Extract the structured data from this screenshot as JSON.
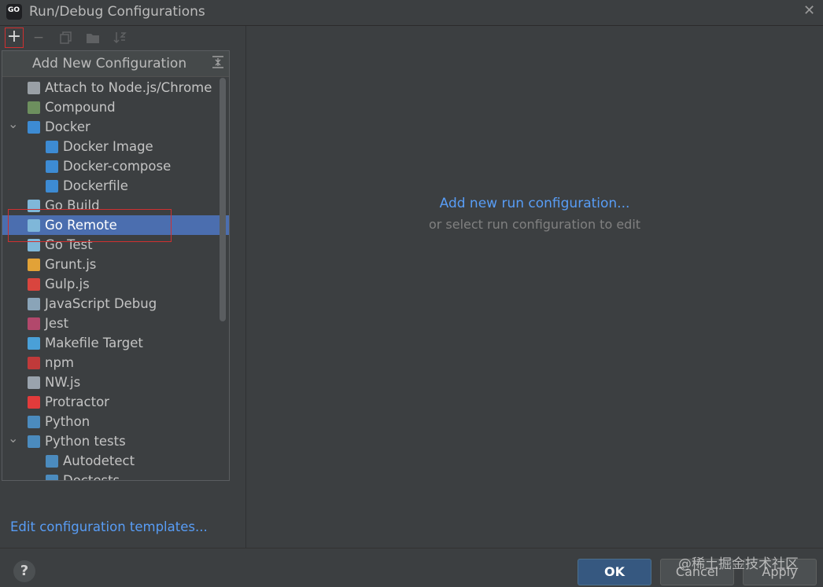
{
  "window": {
    "title": "Run/Debug Configurations",
    "app_icon_text": "GO"
  },
  "popup": {
    "title": "Add New Configuration",
    "items": [
      {
        "label": "Attach to Node.js/Chrome",
        "icon": "nodejs-attach-icon",
        "color": "#9aa0a6"
      },
      {
        "label": "Compound",
        "icon": "compound-icon",
        "color": "#6d8f5e"
      },
      {
        "label": "Docker",
        "icon": "docker-icon",
        "color": "#3d8bd3",
        "expanded": true
      },
      {
        "label": "Docker Image",
        "icon": "docker-icon",
        "color": "#3d8bd3"
      },
      {
        "label": "Docker-compose",
        "icon": "docker-icon",
        "color": "#3d8bd3"
      },
      {
        "label": "Dockerfile",
        "icon": "docker-icon",
        "color": "#3d8bd3"
      },
      {
        "label": "Go Build",
        "icon": "gopher-icon",
        "color": "#7fb7d9"
      },
      {
        "label": "Go Remote",
        "icon": "go-remote-icon",
        "color": "#7fb7d9",
        "selected": true
      },
      {
        "label": "Go Test",
        "icon": "gopher-icon",
        "color": "#7fb7d9"
      },
      {
        "label": "Grunt.js",
        "icon": "grunt-icon",
        "color": "#e2a237"
      },
      {
        "label": "Gulp.js",
        "icon": "gulp-icon",
        "color": "#d9453e"
      },
      {
        "label": "JavaScript Debug",
        "icon": "js-debug-icon",
        "color": "#8aa4b8"
      },
      {
        "label": "Jest",
        "icon": "jest-icon",
        "color": "#b2486c"
      },
      {
        "label": "Makefile Target",
        "icon": "makefile-icon",
        "color": "#4aa0d8"
      },
      {
        "label": "npm",
        "icon": "npm-icon",
        "color": "#c03a3a"
      },
      {
        "label": "NW.js",
        "icon": "nwjs-icon",
        "color": "#9aa3ad"
      },
      {
        "label": "Protractor",
        "icon": "protractor-icon",
        "color": "#e23b3b"
      },
      {
        "label": "Python",
        "icon": "python-icon",
        "color": "#4b8bbe"
      },
      {
        "label": "Python tests",
        "icon": "python-tests-icon",
        "color": "#4b8bbe",
        "expanded": true
      },
      {
        "label": "Autodetect",
        "icon": "python-tests-icon",
        "color": "#4b8bbe"
      },
      {
        "label": "Doctests",
        "icon": "python-tests-icon",
        "color": "#4b8bbe"
      }
    ]
  },
  "left": {
    "edit_templates_link": "Edit configuration templates..."
  },
  "main": {
    "add_new_link": "Add new run configuration...",
    "or_select_text": "or select run configuration to edit"
  },
  "footer": {
    "help_label": "?",
    "ok_label": "OK",
    "cancel_label": "Cancel",
    "apply_label": "Apply",
    "watermark": "@稀土掘金技术社区"
  }
}
